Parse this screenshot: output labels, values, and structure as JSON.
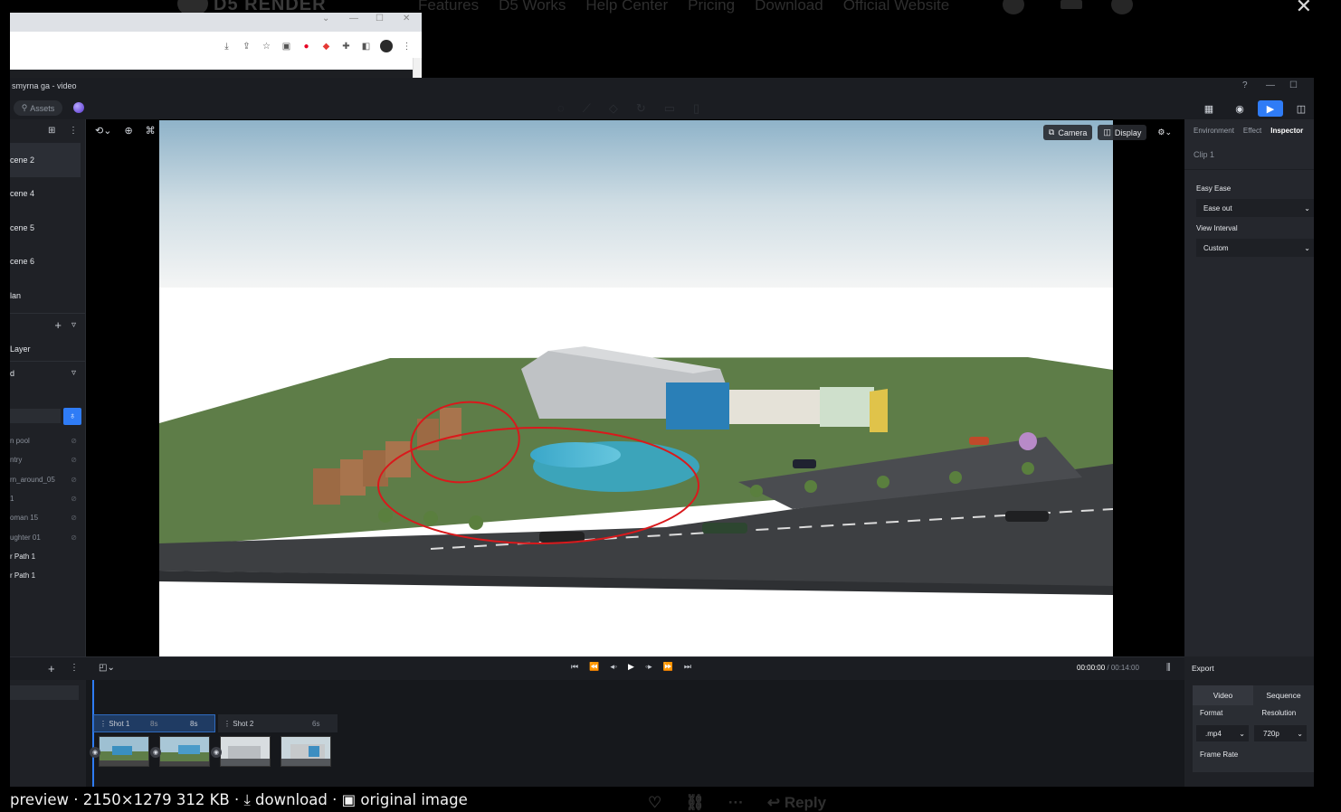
{
  "background_site": {
    "logo": "D5 RENDER",
    "nav": [
      "Features",
      "D5 Works",
      "Help Center",
      "Pricing",
      "Download",
      "Official Website"
    ],
    "close_glyph": "✕"
  },
  "browser": {
    "titlebar_controls": [
      "⌄",
      "—",
      "☐",
      "✕"
    ],
    "toolbar_icons": [
      "download-icon",
      "share-icon",
      "star-icon",
      "extension-icon",
      "pinterest-icon",
      "maps-icon",
      "puzzle-icon",
      "sidepanel-icon",
      "profile-icon",
      "menu-icon"
    ]
  },
  "app": {
    "window_title": "smyrna ga - video",
    "window_controls": [
      "?",
      "—",
      "☐"
    ],
    "toolbar": {
      "assets_label": "Assets"
    },
    "scenes": [
      "cene 2",
      "cene 4",
      "cene 5",
      "cene 6",
      "lan"
    ],
    "layer_label": "Layer",
    "filter_label": "d",
    "objects": [
      {
        "name": "n pool",
        "dim": true
      },
      {
        "name": "ntry",
        "dim": true
      },
      {
        "name": "rn_around_05",
        "dim": true
      },
      {
        "name": "1",
        "dim": true
      },
      {
        "name": "oman 15",
        "dim": true
      },
      {
        "name": "ughter 01",
        "dim": true
      },
      {
        "name": "r Path 1",
        "dim": false
      },
      {
        "name": "r Path 1",
        "dim": false
      }
    ],
    "viewport": {
      "camera_label": "Camera",
      "display_label": "Display"
    },
    "inspector": {
      "tabs": [
        "Environment",
        "Effect",
        "Inspector"
      ],
      "active_tab": "Inspector",
      "clip_title": "Clip 1",
      "easy_ease_label": "Easy Ease",
      "easy_ease_value": "Ease out",
      "view_interval_label": "View Interval",
      "view_interval_value": "Custom"
    },
    "playbar": {
      "current_time": "00:00:00",
      "separator": " / ",
      "total_time": "00:14:00"
    },
    "timeline": {
      "shots": [
        {
          "label": "Shot 1",
          "duration_a": "8s",
          "duration_b": "8s"
        },
        {
          "label": "Shot 2",
          "duration": "6s"
        }
      ]
    },
    "export": {
      "title": "Export",
      "tabs": [
        "Video",
        "Sequence"
      ],
      "active_tab": "Video",
      "format_label": "Format",
      "format_value": ".mp4",
      "resolution_label": "Resolution",
      "resolution_value": "720p",
      "frame_rate_label": "Frame Rate"
    }
  },
  "footer": {
    "preview_label": "preview",
    "image_info": "2150×1279 312 KB",
    "download_label": "download",
    "original_label": "original image",
    "reply_label": "Reply"
  },
  "colors": {
    "accent": "#2f7cf6",
    "annotation": "#d9191c",
    "app_bg": "#1b1d22"
  }
}
